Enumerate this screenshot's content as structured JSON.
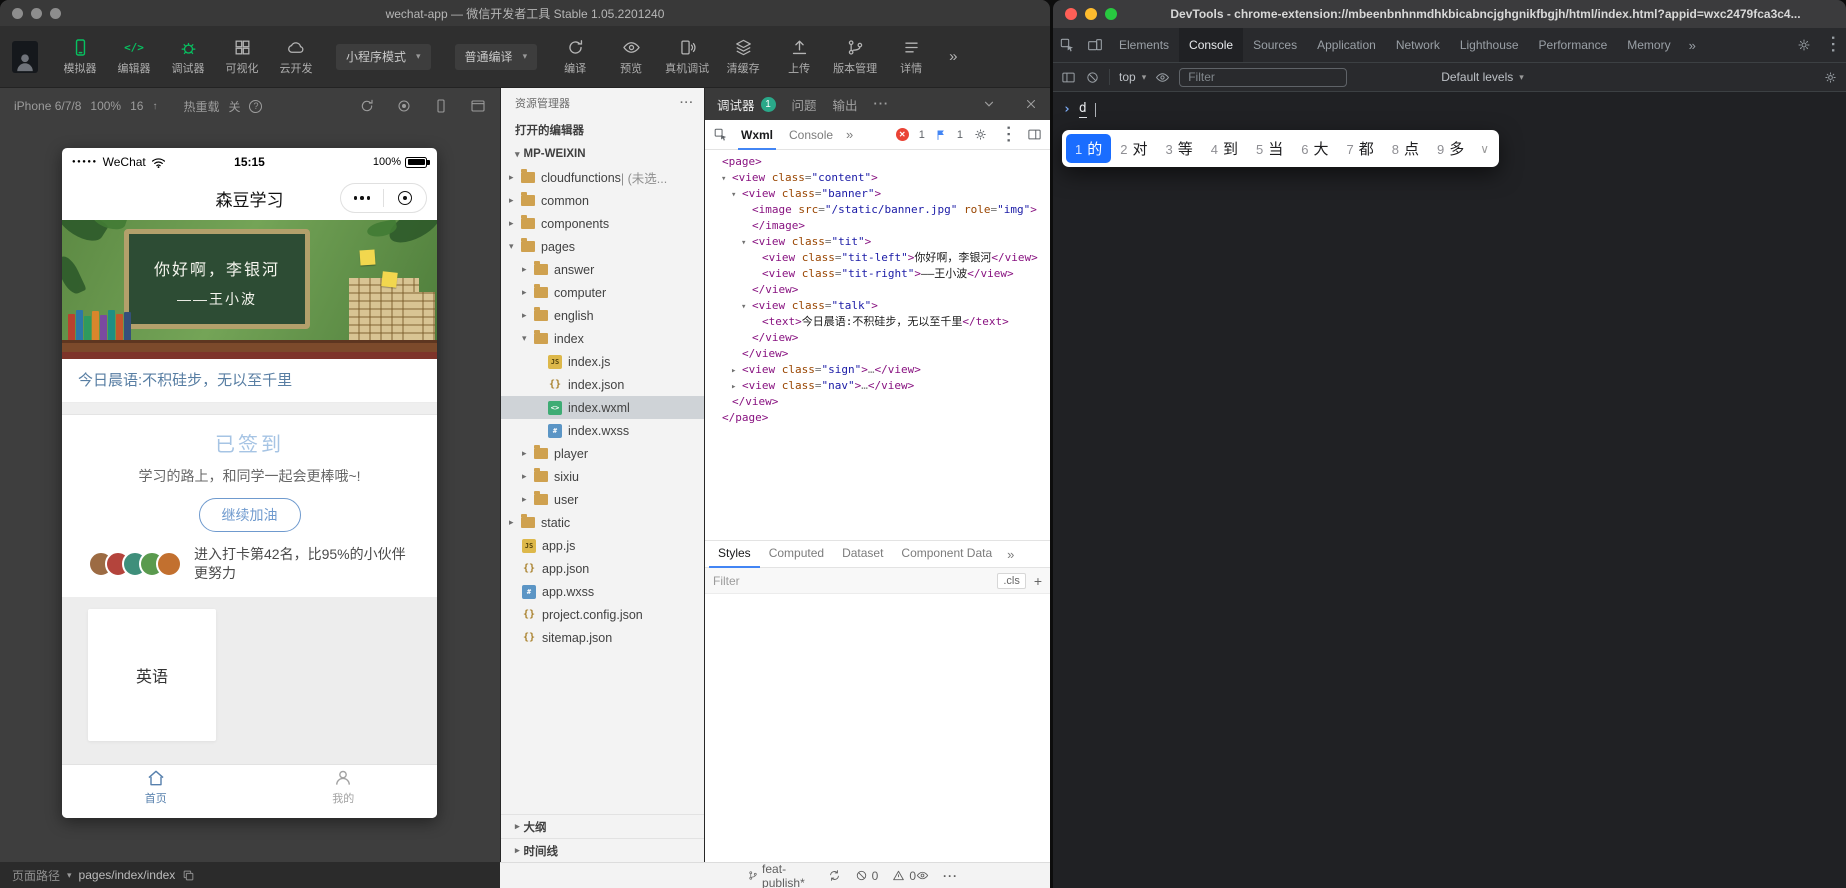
{
  "wx": {
    "title": "wechat-app — 微信开发者工具 Stable 1.05.2201240",
    "toolbar": {
      "tools": [
        {
          "label": "模拟器"
        },
        {
          "label": "编辑器"
        },
        {
          "label": "调试器"
        },
        {
          "label": "可视化"
        },
        {
          "label": "云开发"
        }
      ],
      "mode": "小程序模式",
      "compile_mode": "普通编译",
      "actions": [
        {
          "label": "编译"
        },
        {
          "label": "预览"
        },
        {
          "label": "真机调试"
        },
        {
          "label": "清缓存"
        },
        {
          "label": "上传"
        },
        {
          "label": "版本管理"
        },
        {
          "label": "详情"
        }
      ]
    },
    "sim": {
      "device": "iPhone 6/7/8",
      "zoom": "100%",
      "net": "16",
      "hot_reload": "热重载",
      "hot_reload_state": "关",
      "page_path_label": "页面路径",
      "page_path": "pages/index/index"
    },
    "phone": {
      "carrier": "WeChat",
      "time": "15:15",
      "battery": "100%",
      "nav_title": "森豆学习",
      "banner_line1": "你好啊，李银河",
      "banner_line2": "——王小波",
      "morning": "今日晨语:不积硅步，无以至千里",
      "sign_status": "已签到",
      "sign_subtitle": "学习的路上，和同学一起会更棒哦~!",
      "sign_button": "继续加油",
      "rank_text": "进入打卡第42名，比95%的小伙伴更努力",
      "course_card": "英语",
      "tab_home": "首页",
      "tab_me": "我的"
    },
    "explorer": {
      "header": "资源管理器",
      "open_editors": "打开的编辑器",
      "project": "MP-WEIXIN",
      "tree": [
        {
          "label": "cloudfunctions",
          "suffix": " | (未选...",
          "type": "folder",
          "depth": 0,
          "state": "collapsed"
        },
        {
          "label": "common",
          "type": "folder",
          "depth": 0,
          "state": "collapsed"
        },
        {
          "label": "components",
          "type": "folder",
          "depth": 0,
          "state": "collapsed"
        },
        {
          "label": "pages",
          "type": "folder",
          "depth": 0,
          "state": "expanded"
        },
        {
          "label": "answer",
          "type": "folder",
          "depth": 1,
          "state": "collapsed"
        },
        {
          "label": "computer",
          "type": "folder",
          "depth": 1,
          "state": "collapsed"
        },
        {
          "label": "english",
          "type": "folder",
          "depth": 1,
          "state": "collapsed"
        },
        {
          "label": "index",
          "type": "folder",
          "depth": 1,
          "state": "expanded"
        },
        {
          "label": "index.js",
          "type": "js",
          "depth": 2
        },
        {
          "label": "index.json",
          "type": "json",
          "depth": 2
        },
        {
          "label": "index.wxml",
          "type": "wxml",
          "depth": 2,
          "selected": true
        },
        {
          "label": "index.wxss",
          "type": "wxss",
          "depth": 2
        },
        {
          "label": "player",
          "type": "folder",
          "depth": 1,
          "state": "collapsed"
        },
        {
          "label": "sixiu",
          "type": "folder",
          "depth": 1,
          "state": "collapsed"
        },
        {
          "label": "user",
          "type": "folder",
          "depth": 1,
          "state": "collapsed"
        },
        {
          "label": "static",
          "type": "folder",
          "depth": 0,
          "state": "collapsed"
        },
        {
          "label": "app.js",
          "type": "js",
          "depth": 0
        },
        {
          "label": "app.json",
          "type": "json",
          "depth": 0
        },
        {
          "label": "app.wxss",
          "type": "wxss",
          "depth": 0
        },
        {
          "label": "project.config.json",
          "type": "json",
          "depth": 0
        },
        {
          "label": "sitemap.json",
          "type": "json",
          "depth": 0
        }
      ],
      "outline": "大纲",
      "timeline": "时间线",
      "branch": "feat-publish*",
      "error_count": "0",
      "warning_count": "0"
    },
    "debugger": {
      "tabs": [
        {
          "label": "调试器",
          "badge": "1"
        },
        {
          "label": "问题"
        },
        {
          "label": "输出"
        }
      ],
      "inner_tabs": [
        {
          "label": "Wxml",
          "active": true
        },
        {
          "label": "Console",
          "active": false
        }
      ],
      "error_count": "1",
      "flag_count": "1",
      "wxml": [
        {
          "indent": 0,
          "parts": [
            [
              "t",
              "<page>"
            ]
          ]
        },
        {
          "indent": 1,
          "arrow": "open",
          "parts": [
            [
              "t",
              "<view"
            ],
            [
              "n",
              " class"
            ],
            [
              "g",
              "="
            ],
            [
              "v",
              "\"content\""
            ],
            [
              "t",
              ">"
            ]
          ]
        },
        {
          "indent": 2,
          "arrow": "open",
          "parts": [
            [
              "t",
              "<view"
            ],
            [
              "n",
              " class"
            ],
            [
              "g",
              "="
            ],
            [
              "v",
              "\"banner\""
            ],
            [
              "t",
              ">"
            ]
          ]
        },
        {
          "indent": 3,
          "parts": [
            [
              "t",
              "<image"
            ],
            [
              "n",
              " src"
            ],
            [
              "g",
              "="
            ],
            [
              "v",
              "\"/static/banner.jpg\""
            ],
            [
              "n",
              " role"
            ],
            [
              "g",
              "="
            ],
            [
              "v",
              "\"img\""
            ],
            [
              "t",
              ">"
            ]
          ]
        },
        {
          "indent": 3,
          "parts": [
            [
              "t",
              "</image>"
            ]
          ]
        },
        {
          "indent": 3,
          "arrow": "open",
          "parts": [
            [
              "t",
              "<view"
            ],
            [
              "n",
              " class"
            ],
            [
              "g",
              "="
            ],
            [
              "v",
              "\"tit\""
            ],
            [
              "t",
              ">"
            ]
          ]
        },
        {
          "indent": 4,
          "parts": [
            [
              "t",
              "<view"
            ],
            [
              "n",
              " class"
            ],
            [
              "g",
              "="
            ],
            [
              "v",
              "\"tit-left\""
            ],
            [
              "t",
              ">"
            ],
            [
              "x",
              "你好啊，李银河"
            ],
            [
              "t",
              "</view>"
            ]
          ]
        },
        {
          "indent": 4,
          "parts": [
            [
              "t",
              "<view"
            ],
            [
              "n",
              " class"
            ],
            [
              "g",
              "="
            ],
            [
              "v",
              "\"tit-right\""
            ],
            [
              "t",
              ">"
            ],
            [
              "x",
              "——王小波"
            ],
            [
              "t",
              "</view>"
            ]
          ]
        },
        {
          "indent": 3,
          "parts": [
            [
              "t",
              "</view>"
            ]
          ]
        },
        {
          "indent": 3,
          "arrow": "open",
          "parts": [
            [
              "t",
              "<view"
            ],
            [
              "n",
              " class"
            ],
            [
              "g",
              "="
            ],
            [
              "v",
              "\"talk\""
            ],
            [
              "t",
              ">"
            ]
          ]
        },
        {
          "indent": 4,
          "parts": [
            [
              "t",
              "<text>"
            ],
            [
              "x",
              "今日晨语:不积硅步，无以至千里"
            ],
            [
              "t",
              "</text>"
            ]
          ]
        },
        {
          "indent": 3,
          "parts": [
            [
              "t",
              "</view>"
            ]
          ]
        },
        {
          "indent": 2,
          "parts": [
            [
              "t",
              "</view>"
            ]
          ]
        },
        {
          "indent": 2,
          "arrow": "closed",
          "parts": [
            [
              "t",
              "<view"
            ],
            [
              "n",
              " class"
            ],
            [
              "g",
              "="
            ],
            [
              "v",
              "\"sign\""
            ],
            [
              "t",
              ">"
            ],
            [
              "e",
              "…"
            ],
            [
              "t",
              "</view>"
            ]
          ]
        },
        {
          "indent": 2,
          "arrow": "closed",
          "parts": [
            [
              "t",
              "<view"
            ],
            [
              "n",
              " class"
            ],
            [
              "g",
              "="
            ],
            [
              "v",
              "\"nav\""
            ],
            [
              "t",
              ">"
            ],
            [
              "e",
              "…"
            ],
            [
              "t",
              "</view>"
            ]
          ]
        },
        {
          "indent": 1,
          "parts": [
            [
              "t",
              "</view>"
            ]
          ]
        },
        {
          "indent": 0,
          "parts": [
            [
              "t",
              "</page>"
            ]
          ]
        }
      ],
      "style_tabs": [
        {
          "label": "Styles",
          "active": true
        },
        {
          "label": "Computed"
        },
        {
          "label": "Dataset"
        },
        {
          "label": "Component Data"
        }
      ],
      "filter_placeholder": "Filter",
      "cls": ".cls"
    }
  },
  "cr": {
    "title": "DevTools - chrome-extension://mbeenbnhnmdhkbicabncjghgnikfbgjh/html/index.html?appid=wxc2479fca3c4...",
    "tabs": [
      "Elements",
      "Console",
      "Sources",
      "Application",
      "Network",
      "Lighthouse",
      "Performance",
      "Memory"
    ],
    "active_tab": "Console",
    "context": "top",
    "filter_placeholder": "Filter",
    "levels": "Default levels",
    "prompt_text": "d",
    "ime": {
      "candidates": [
        {
          "n": "1",
          "c": "的",
          "selected": true
        },
        {
          "n": "2",
          "c": "对"
        },
        {
          "n": "3",
          "c": "等"
        },
        {
          "n": "4",
          "c": "到"
        },
        {
          "n": "5",
          "c": "当"
        },
        {
          "n": "6",
          "c": "大"
        },
        {
          "n": "7",
          "c": "都"
        },
        {
          "n": "8",
          "c": "点"
        },
        {
          "n": "9",
          "c": "多"
        }
      ]
    }
  },
  "colors": {
    "wechat_green": "#07c160",
    "accent_blue": "#5780ad",
    "mac_red": "#ff5f57",
    "mac_yellow": "#febc2e",
    "mac_green": "#28c840",
    "ime_selection": "#1a6dff",
    "badge_teal": "#2aa889",
    "error_red": "#ea4335"
  }
}
